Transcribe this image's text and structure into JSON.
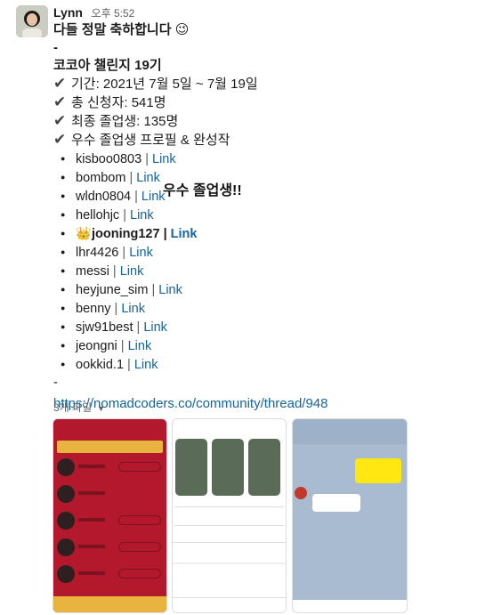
{
  "message": {
    "author": "Lynn",
    "time": "오후 5:52",
    "greeting": "다들 정말 축하합니다 😉",
    "dash1": "-",
    "challenge_title": "코코아 챌린지 19기",
    "checks": [
      {
        "icon": "check-mark-icon",
        "text": "기간: 2021년 7월 5일 ~ 7월 19일"
      },
      {
        "icon": "check-mark-icon",
        "text": "총 신청자: 541명"
      },
      {
        "icon": "check-mark-icon",
        "text": "최종 졸업생: 135명"
      },
      {
        "icon": "check-mark-icon",
        "text": "우수 졸업생 프로필 & 완성작"
      }
    ],
    "graduates": [
      {
        "name": "kisboo0803",
        "link": "Link"
      },
      {
        "name": "bombom",
        "link": "Link"
      },
      {
        "name": "wldn0804",
        "link": "Link"
      },
      {
        "name": "hellohjc",
        "link": "Link"
      },
      {
        "name": "jooning127",
        "link": "Link",
        "crown": "👑"
      },
      {
        "name": "lhr4426",
        "link": "Link"
      },
      {
        "name": "messi",
        "link": "Link"
      },
      {
        "name": "heyjune_sim",
        "link": "Link"
      },
      {
        "name": "benny",
        "link": "Link"
      },
      {
        "name": "sjw91best",
        "link": "Link"
      },
      {
        "name": "jeongni",
        "link": "Link"
      },
      {
        "name": "ookkid.1",
        "link": "Link"
      }
    ],
    "separator": "|",
    "dash2": "-",
    "url": "https://nomadcoders.co/community/thread/948",
    "files_label": "3개 파일"
  },
  "annotation": "우수 졸업생!!"
}
